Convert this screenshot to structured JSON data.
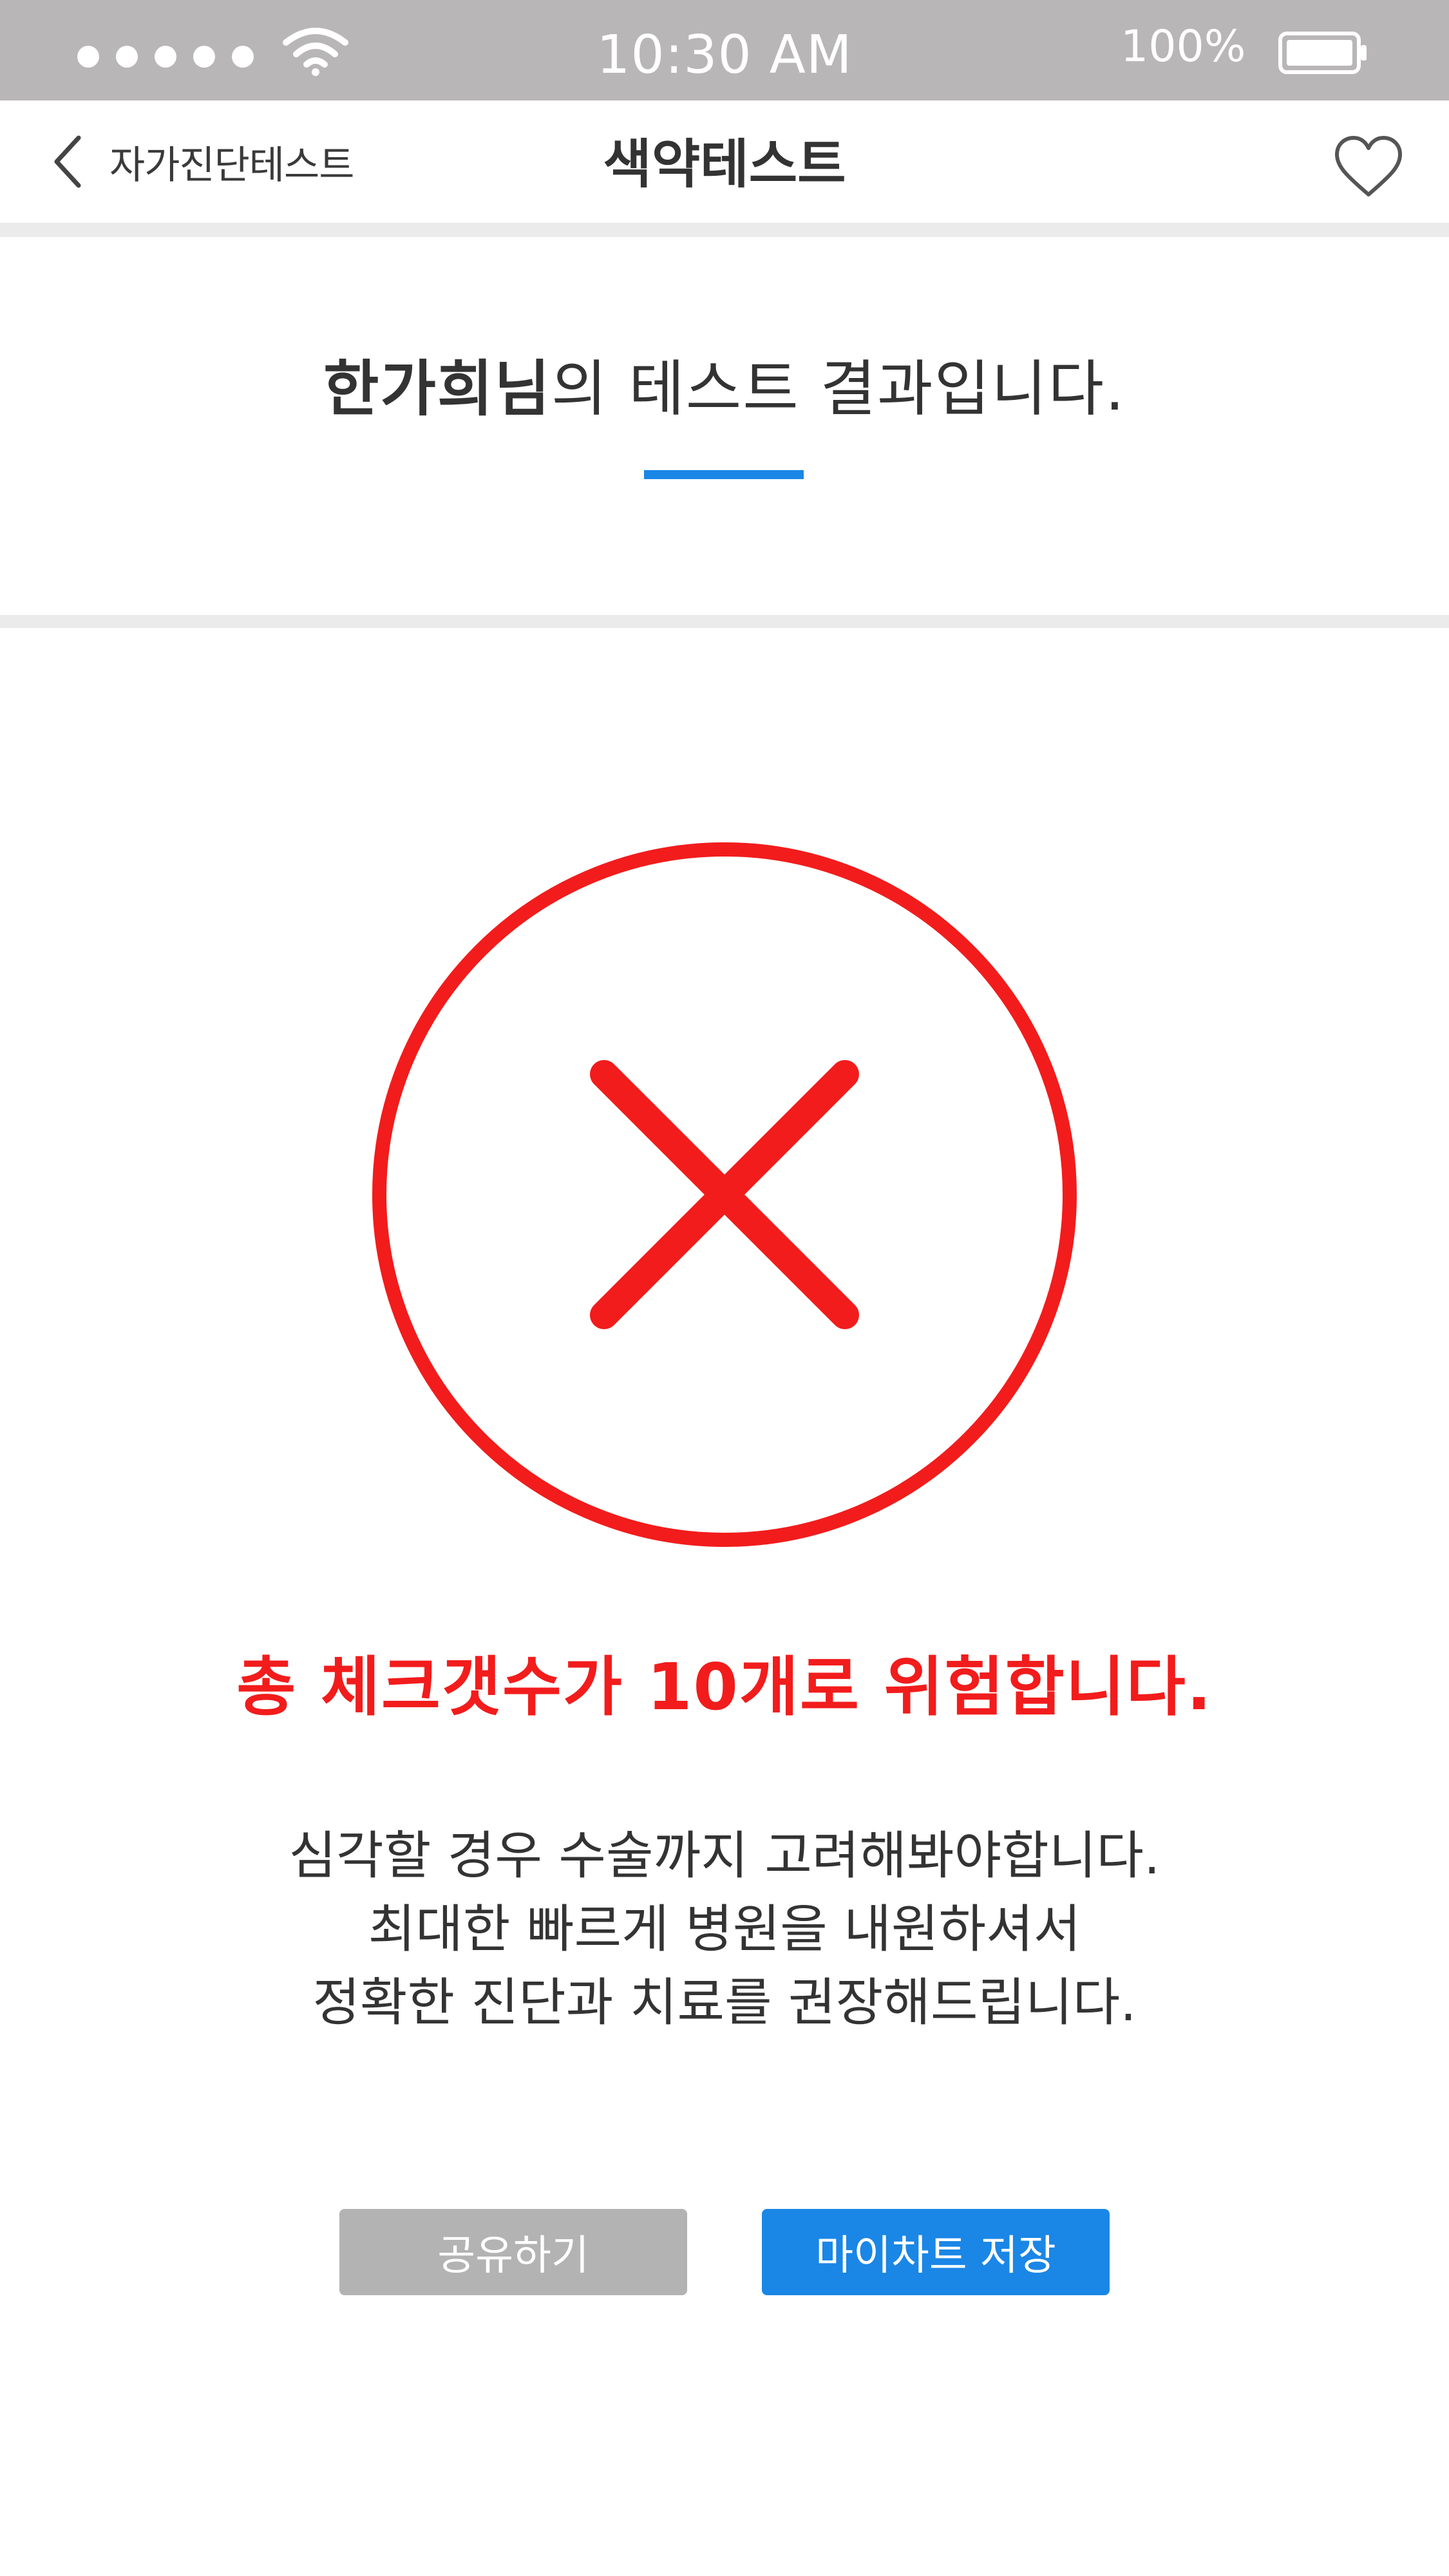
{
  "status_bar": {
    "time": "10:30 AM",
    "battery": "100%",
    "signal_icon": "signal-dots-icon",
    "wifi_icon": "wifi-icon",
    "battery_icon": "battery-icon"
  },
  "nav": {
    "back_label": "자가진단테스트",
    "back_icon": "chevron-left-icon",
    "title": "색약테스트",
    "favorite_icon": "heart-outline-icon"
  },
  "result": {
    "user_name": "한가희님",
    "heading_suffix": "의 테스트 결과입니다.",
    "status_icon": "x-circle-icon",
    "warning": "총 체크갯수가 10개로 위험합니다.",
    "advice_lines": [
      "심각할 경우 수술까지 고려해봐야합니다.",
      "최대한 빠르게 병원을 내원하셔서",
      "정확한 진단과 치료를 권장해드립니다."
    ]
  },
  "actions": {
    "share_label": "공유하기",
    "save_label": "마이차트 저장"
  },
  "colors": {
    "accent_blue": "#1a86e6",
    "danger_red": "#f21c1c",
    "status_bar_gray": "#b8b6b7",
    "share_button_gray": "#b3b3b3"
  }
}
